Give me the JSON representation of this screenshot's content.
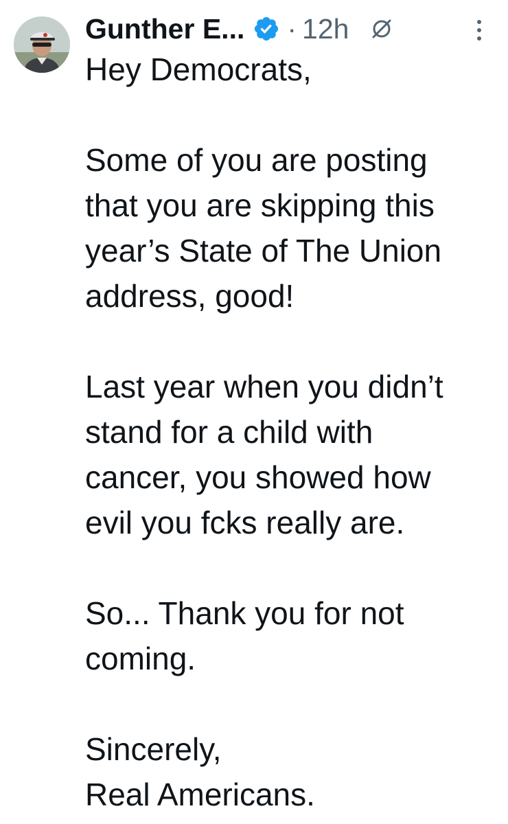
{
  "tweet": {
    "author_name": "Gunther E...",
    "separator": "·",
    "time": "12h",
    "icons": {
      "avatar": "avatar",
      "verified": "verified-badge-icon",
      "grok": "grok-icon",
      "more": "more-options-icon"
    },
    "colors": {
      "verified_blue": "#1d9bf0",
      "secondary_text": "#536471",
      "primary_text": "#0f1419"
    },
    "paragraphs": [
      [
        "Hey Democrats,"
      ],
      [
        "Some of you are posting",
        "that you are skipping this",
        "year’s State of The Union",
        "address, good!"
      ],
      [
        "Last year when you didn’t",
        "stand for a child with",
        "cancer, you showed how",
        "evil you fcks really are."
      ],
      [
        "So... Thank you for not",
        "coming."
      ],
      [
        "Sincerely,",
        "Real Americans."
      ]
    ]
  }
}
